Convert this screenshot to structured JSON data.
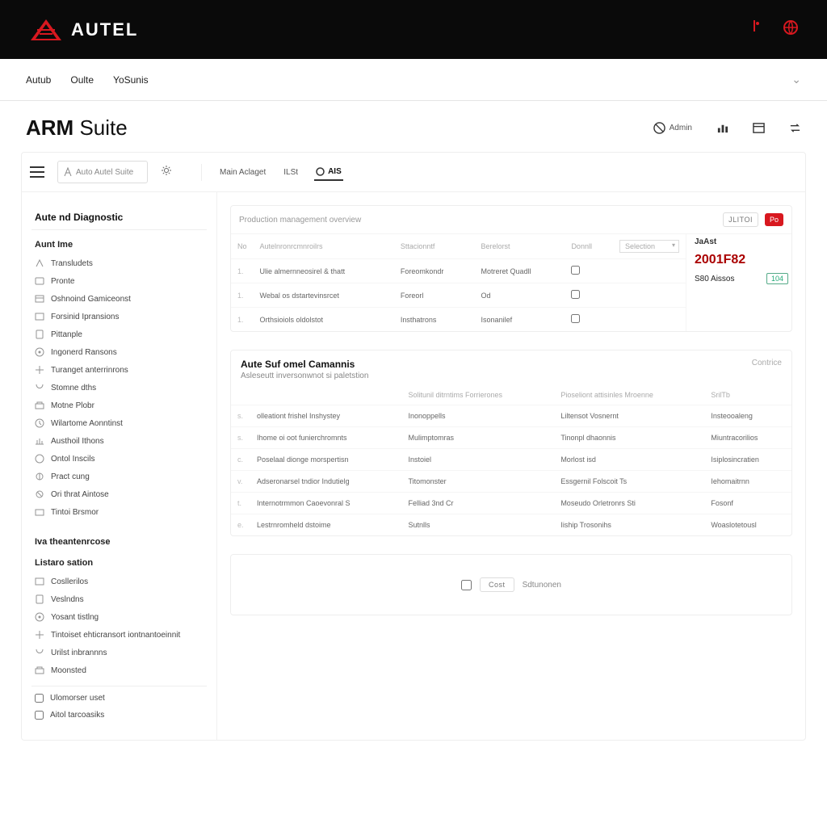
{
  "brand": "AUTEL",
  "subnav": [
    "Autub",
    "Oulte",
    "YoSunis"
  ],
  "product_title_bold": "ARM",
  "product_title_light": "Suite",
  "product_actions": [
    {
      "icon": "block",
      "label": "Admin"
    },
    {
      "icon": "bars",
      "label": ""
    },
    {
      "icon": "panel",
      "label": ""
    },
    {
      "icon": "swap",
      "label": ""
    }
  ],
  "search_placeholder": "Auto Autel Suite",
  "toolbar_tabs": [
    {
      "label": "Main Aclaget"
    },
    {
      "label": "ILSt"
    },
    {
      "label": "AIS",
      "active": true
    }
  ],
  "sidebar": {
    "section1": "Aute nd Diagnostic",
    "sub1": "Aunt Ime",
    "items1": [
      "Transludets",
      "Pronte",
      "Oshnoind Gamiceonst",
      "Forsinid Ipransions",
      "Pittanple",
      "Ingonerd Ransons",
      "Turanget anterrinrons",
      "Stomne dths",
      "Motne Plobr",
      "Wilartome Aonntinst",
      "Austhoil Ithons",
      "Ontol Inscils",
      "Pract cung",
      "Ori thrat Aintose",
      "Tintoi Brsmor"
    ],
    "section2": "Iva theantenrcose",
    "sub2": "Listaro sation",
    "items2": [
      "Cosllerilos",
      "Veslndns",
      "Yosant tistlng",
      "Tintoiset ehticransort iontnantoeinnit",
      "Urilst inbrannns",
      "Moonsted"
    ],
    "items3": [
      "Ulomorser uset",
      "Aitol tarcoasiks"
    ]
  },
  "card1": {
    "head_hint": "Production management overview",
    "btn_light": "JLITOI",
    "btn_red": "Po",
    "headers": [
      "No",
      "Autelnronrcmnroilrs",
      "Sttacionntf",
      "Berelorst",
      "Donnll"
    ],
    "select_label": "Selection",
    "rows": [
      {
        "idx": "1.",
        "a": "Ulie almernneosirel & thatt",
        "b": "Foreomkondr",
        "c": "Motreret Quadll"
      },
      {
        "idx": "1.",
        "a": "Webal os dstartevinsrcet",
        "b": "Foreorl",
        "c": "Od"
      },
      {
        "idx": "1.",
        "a": "Orthsioiols oldolstot",
        "b": "Insthatrons",
        "c": "Isonanilef"
      }
    ],
    "info": {
      "label": "JaAst",
      "price": "2001F82",
      "sub_label": "S80 Aissos",
      "tag": "104"
    }
  },
  "card2": {
    "title": "Aute Suf omel Camannis",
    "subtitle": "Asleseutt inversonwnot si paletstion",
    "link": "Contrice",
    "headers": [
      "",
      "",
      "Solitunil ditrntims Forrierones",
      "Pioseliont attisinles Mroenne",
      "SrilTb"
    ],
    "rows": [
      {
        "idx": "s.",
        "a": "olleationt frishel Inshystey",
        "b": "Inonoppells",
        "c": "Liltensot Vosnernt",
        "d": "Insteooaleng"
      },
      {
        "idx": "s.",
        "a": "Ihome oi oot funierchromnts",
        "b": "Mulimptomras",
        "c": "Tinonpl dhaonnis",
        "d": "Miuntracorilios"
      },
      {
        "idx": "c.",
        "a": "Poselaal dionge morspertisn",
        "b": "Instoiel",
        "c": "Morlost isd",
        "d": "Isiplosincratien"
      },
      {
        "idx": "v.",
        "a": "Adseronarsel tndior Indutielg",
        "b": "Titomonster",
        "c": "Essgernil Folscoit Ts",
        "d": "Iehomaitrnn"
      },
      {
        "idx": "t.",
        "a": "Internotrmmon Caoevonral S",
        "b": "Felliad 3nd Cr",
        "c": "Moseudo Orletronrs Sti",
        "d": "Fosonf"
      },
      {
        "idx": "e.",
        "a": "Lestrnromheld dstoime",
        "b": "Sutnlls",
        "c": "Iiship Trosonihs",
        "d": "Woaslotetousl"
      }
    ]
  },
  "bottom": {
    "btn": "Cost",
    "label": "Sdtunonen"
  }
}
